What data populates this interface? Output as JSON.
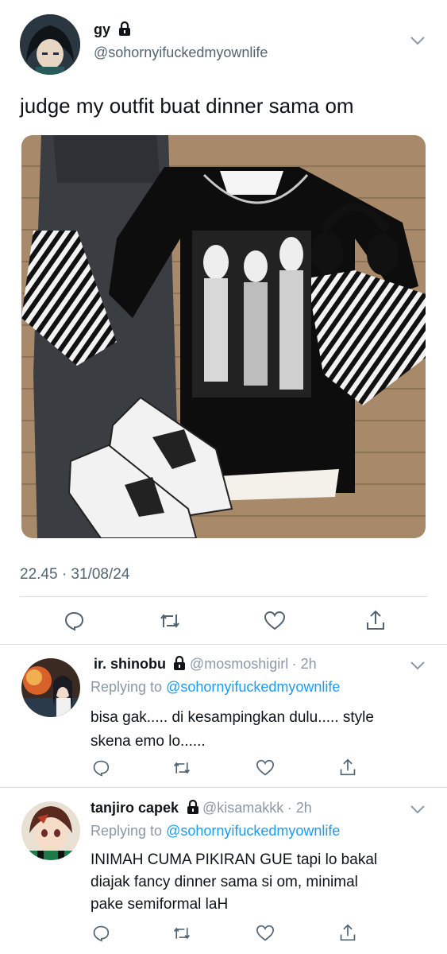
{
  "main_tweet": {
    "display_name": "gy",
    "handle": "@sohornyifuckedmyownlife",
    "text": "judge my outfit buat dinner sama om",
    "timestamp": "22.45 · 31/08/24",
    "image_alt": "outfit photo"
  },
  "actions": [
    "reply-icon",
    "retweet-icon",
    "like-icon",
    "share-icon"
  ],
  "replies": [
    {
      "display_name": "ir. shinobu",
      "handle": "@mosmoshigirl",
      "time": "· 2h",
      "replying_prefix": "Replying to",
      "replying_to": "@sohornyifuckedmyownlife",
      "text_line1": "bisa gak..... di kesampingkan dulu..... style",
      "text_line2": "skena emo lo......"
    },
    {
      "display_name": "tanjiro capek",
      "handle": "@kisamakkk",
      "time": "· 2h",
      "replying_prefix": "Replying to",
      "replying_to": "@sohornyifuckedmyownlife",
      "text_line1": "INIMAH CUMA PIKIRAN GUE tapi lo bakal",
      "text_line2": "diajak fancy dinner sama si om, minimal",
      "text_line3": "pake semiformal laH"
    }
  ],
  "colors": {
    "link": "#1d9bf0",
    "muted": "#536471",
    "divider": "#d9dde1"
  }
}
